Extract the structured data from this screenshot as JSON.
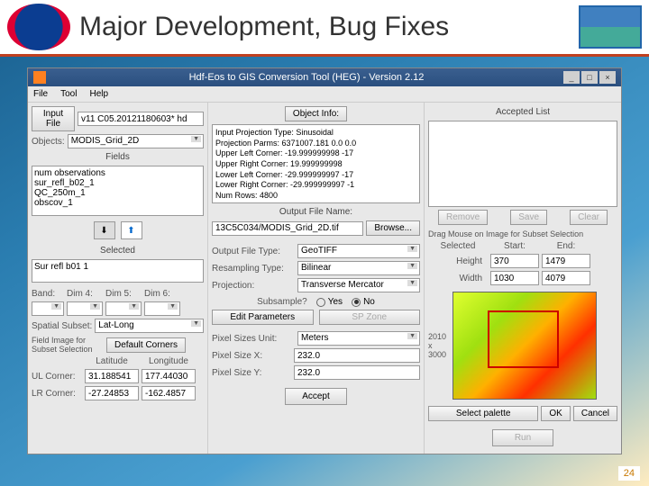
{
  "slide": {
    "title": "Major Development, Bug Fixes",
    "page": "24"
  },
  "window": {
    "title": "Hdf-Eos to GIS Conversion Tool (HEG) - Version 2.12",
    "min": "_",
    "max": "□",
    "close": "×"
  },
  "menu": {
    "file": "File",
    "tool": "Tool",
    "help": "Help"
  },
  "left": {
    "input_lbl": "Input File",
    "input_val": "v11 C05.20121180603* hd",
    "objects_lbl": "Objects:",
    "objects_val": "MODIS_Grid_2D",
    "fields_hdr": "Fields",
    "fields": [
      "num observations",
      "sur_refl_b02_1",
      "QC_250m_1",
      "obscov_1"
    ],
    "selected_hdr": "Selected",
    "selected_val": "Sur refl b01 1",
    "band_lbl": "Band:",
    "d4": "Dim 4:",
    "d5": "Dim 5:",
    "d6": "Dim 6:",
    "spatial_lbl": "Spatial Subset:",
    "spatial_val": "Lat-Long",
    "fieldimg_lbl": "Field Image for\nSubset Selection",
    "defcorners": "Default Corners",
    "lat": "Latitude",
    "lon": "Longitude",
    "ul": "UL Corner:",
    "lr": "LR Corner:",
    "ul_lat": "31.188541",
    "ul_lon": "177.44030",
    "lr_lat": "-27.24853",
    "lr_lon": "-162.4857"
  },
  "mid": {
    "objinfo_btn": "Object Info:",
    "info": {
      "l1": "Input Projection Type: Sinusoidal",
      "l2": "Projection Parms: 6371007.181  0.0  0.0",
      "l3": "Upper Left Corner:  -19.999999998  -17",
      "l4": "Upper Right Corner:   19.999999998",
      "l5": "Lower Left Corner:  -29.999999997  -17",
      "l6": "Lower Right Corner:  -29.999999997  -1",
      "l7": "Num Rows: 4800"
    },
    "outfile_hdr": "Output File Name:",
    "outfile_val": "13C5C034/MODIS_Grid_2D.tif",
    "browse": "Browse...",
    "oft_lbl": "Output File Type:",
    "oft_val": "GeoTIFF",
    "res_lbl": "Resampling Type:",
    "res_val": "Bilinear",
    "proj_lbl": "Projection:",
    "proj_val": "Transverse Mercator",
    "sub_lbl": "Subsample?",
    "yes": "Yes",
    "no": "No",
    "editparam": "Edit Parameters",
    "spzone": "SP Zone",
    "psu_lbl": "Pixel Sizes Unit:",
    "psu_val": "Meters",
    "psx_lbl": "Pixel Size X:",
    "psx_val": "232.0",
    "psy_lbl": "Pixel Size Y:",
    "psy_val": "232.0",
    "accept": "Accept"
  },
  "right": {
    "accepted_hdr": "Accepted List",
    "remove": "Remove",
    "save": "Save",
    "clear": "Clear",
    "drag_lbl": "Drag Mouse on Image for Subset Selection",
    "selected": "Selected",
    "start": "Start:",
    "end": "End:",
    "h_lbl": "Height",
    "h_s": "370",
    "h_e": "1479",
    "w_lbl": "Width",
    "w_s": "1030",
    "w_e": "4079",
    "dims": "2010 x 3000",
    "selpal": "Select palette",
    "ok": "OK",
    "cancel": "Cancel",
    "run": "Run"
  }
}
